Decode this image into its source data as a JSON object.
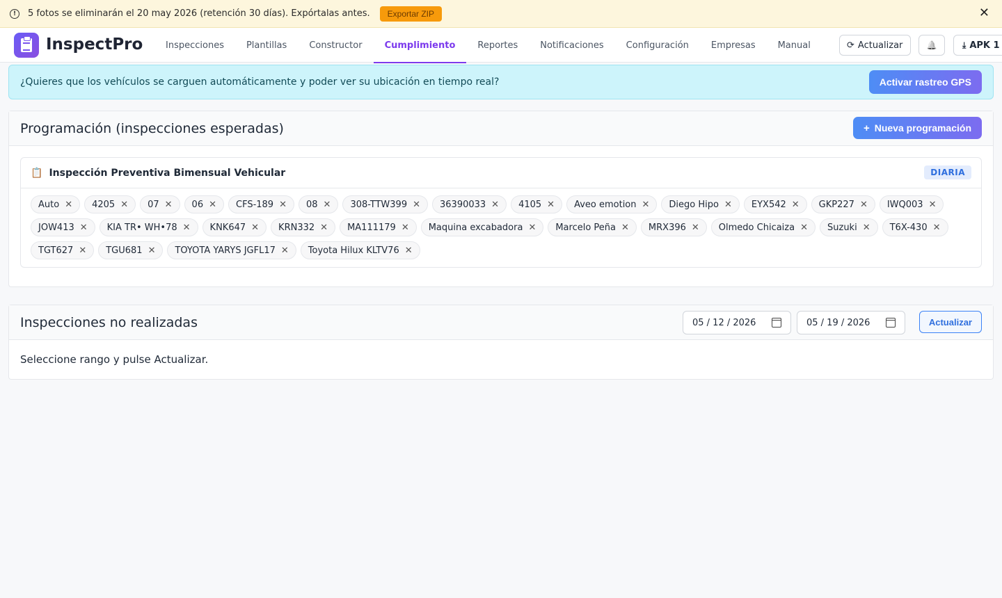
{
  "banner": {
    "message": "5 fotos se eliminarán el 20 may 2026 (retención 30 días). Expórtalas antes.",
    "export_label": "Exportar ZIP",
    "close_glyph": "✕",
    "info_glyph": "!"
  },
  "header": {
    "brand": "InspectPro",
    "nav": [
      {
        "label": "Inspecciones",
        "active": false
      },
      {
        "label": "Plantillas",
        "active": false
      },
      {
        "label": "Constructor",
        "active": false
      },
      {
        "label": "Cumplimiento",
        "active": true
      },
      {
        "label": "Reportes",
        "active": false
      },
      {
        "label": "Notificaciones",
        "active": false
      },
      {
        "label": "Configuración",
        "active": false
      },
      {
        "label": "Empresas",
        "active": false
      },
      {
        "label": "Manual",
        "active": false
      }
    ],
    "refresh_label": "Actualizar",
    "refresh_glyph": "⟳",
    "bell_glyph": "🔔",
    "apk_label": "APK 1",
    "apk_glyph": "⤓"
  },
  "gps": {
    "message": "¿Quieres que los vehículos se carguen automáticamente y poder ver su ubicación en tiempo real?",
    "button_label": "Activar rastreo GPS"
  },
  "programacion": {
    "title": "Programación (inspecciones esperadas)",
    "new_label": "Nueva programación",
    "new_glyph": "+",
    "schedule": {
      "icon_glyph": "📋",
      "title": "Inspección Preventiva Bimensual Vehicular",
      "frequency": "DIARIA",
      "chips": [
        "Auto",
        "4205",
        "07",
        "06",
        "CFS-189",
        "08",
        "308-TTW399",
        "36390033",
        "4105",
        "Aveo emotion",
        "Diego Hipo",
        "EYX542",
        "GKP227",
        "IWQ003",
        "JOW413",
        "KIA TR• WH•78",
        "KNK647",
        "KRN332",
        "MA111179",
        "Maquina excabadora",
        "Marcelo Peña",
        "MRX396",
        "Olmedo Chicaiza",
        "Suzuki",
        "T6X-430",
        "TGT627",
        "TGU681",
        "TOYOTA YARYS JGFL17",
        "Toyota Hilux KLTV76"
      ],
      "remove_glyph": "✕"
    }
  },
  "missed": {
    "title": "Inspecciones no realizadas",
    "date_from": "05 / 12 / 2026",
    "date_to": "05 / 19 / 2026",
    "update_label": "Actualizar",
    "hint": "Seleccione rango y pulse Actualizar."
  },
  "colors": {
    "accent": "#7c3aed",
    "banner_bg": "#fdf6dd",
    "export_btn": "#f79a0b",
    "gps_bg": "#cdf4fb",
    "primary_gradient_start": "#4e8df5",
    "primary_gradient_end": "#7c6cf0"
  }
}
